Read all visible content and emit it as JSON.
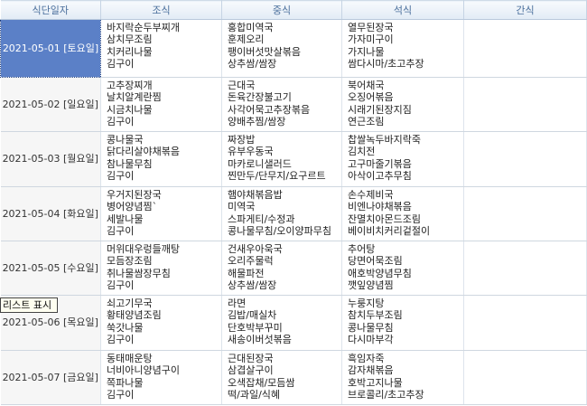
{
  "headers": {
    "date": "식단일자",
    "breakfast": "조식",
    "lunch": "중식",
    "dinner": "석식",
    "snack": "간식"
  },
  "rows": [
    {
      "date": "2021-05-01 [토요일]",
      "breakfast": [
        "바지락순두부찌개",
        "삼치무조림",
        "치커리나물",
        "김구이"
      ],
      "lunch": [
        "홍합미역국",
        "훈제오리",
        "팽이버섯맛살볶음",
        "상추쌈/쌈장"
      ],
      "dinner": [
        "열무된장국",
        "가자미구이",
        "가지나물",
        "쌈다시마/초고추장"
      ],
      "snack": []
    },
    {
      "date": "2021-05-02 [일요일]",
      "breakfast": [
        "고추장찌개",
        "날치알계란찜",
        "시금치나물",
        "김구이"
      ],
      "lunch": [
        "근대국",
        "돈육간장불고기",
        "사각어묵고추장볶음",
        "양배추찜/쌈장"
      ],
      "dinner": [
        "북어채국",
        "오징어볶음",
        "시래기된장지짐",
        "연근조림"
      ],
      "snack": []
    },
    {
      "date": "2021-05-03 [월요일]",
      "breakfast": [
        "콩나물국",
        "닭다리살야채볶음",
        "참나물무침",
        "김구이"
      ],
      "lunch": [
        "짜장밥",
        "유부우동국",
        "마카로니샐러드",
        "찐만두/단무지/요구르트"
      ],
      "dinner": [
        "찹쌀녹두바지락죽",
        "김치전",
        "고구마줄기볶음",
        "아삭이고추무침"
      ],
      "snack": []
    },
    {
      "date": "2021-05-04 [화요일]",
      "breakfast": [
        "우거지된장국",
        "병어양념찜`",
        "세발나물",
        "김구이"
      ],
      "lunch": [
        "햄야채볶음밥",
        "미역국",
        "스파게티/수정과",
        "콩나물무침/오이양파무침"
      ],
      "dinner": [
        "손수제비국",
        "비엔나야채볶음",
        "잔멸치아몬드조림",
        "베이비치커리겉절이"
      ],
      "snack": []
    },
    {
      "date": "2021-05-05 [수요일]",
      "breakfast": [
        "머위대우렁들깨탕",
        "모듬장조림",
        "취나물쌈장무침",
        "김구이"
      ],
      "lunch": [
        "건새우아욱국",
        "오리주물럭",
        "해물파전",
        "상추쌈/쌈장"
      ],
      "dinner": [
        "추어탕",
        "당면어묵조림",
        "애호박양념무침",
        "깻잎양념찜"
      ],
      "snack": []
    },
    {
      "date": "2021-05-06 [목요일]",
      "breakfast": [
        "쇠고기무국",
        "황태양념조림",
        "쑥갓나물",
        "김구이"
      ],
      "lunch": [
        "라면",
        "김밥/매실차",
        "단호박부꾸미",
        "새송이버섯볶음"
      ],
      "dinner": [
        "누룽지탕",
        "참치두부조림",
        "콩나물무침",
        "다시마부각"
      ],
      "snack": []
    },
    {
      "date": "2021-05-07 [금요일]",
      "breakfast": [
        "동태매운탕",
        "너비아니양념구이",
        "쪽파나물",
        "김구이"
      ],
      "lunch": [
        "근대된장국",
        "삼겹살구이",
        "오색잡채/모듬쌈",
        "떡/과일/식혜"
      ],
      "dinner": [
        "흑임자죽",
        "감자채볶음",
        "호박고지나물",
        "브로콜리/초고추장"
      ],
      "snack": []
    }
  ],
  "tooltip": "리스트 표시"
}
